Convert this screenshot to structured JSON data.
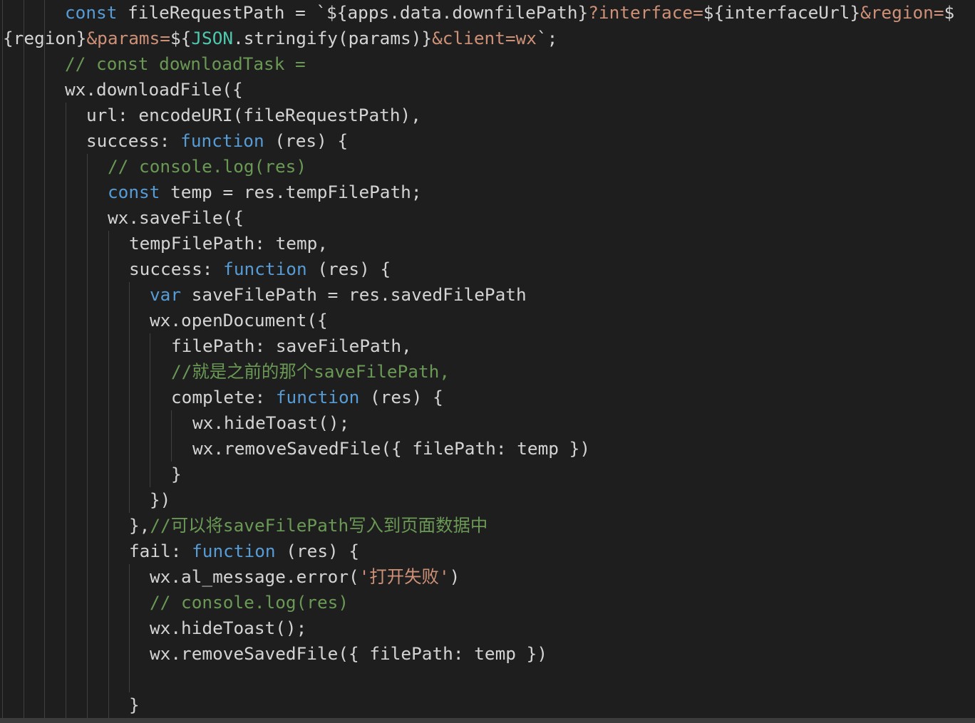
{
  "editor": {
    "colors": {
      "background": "#1e1e1e",
      "keyword": "#569cd6",
      "plain": "#d4d4d4",
      "string": "#ce9178",
      "comment": "#6a9955",
      "type": "#4ec9b0",
      "indent_guide": "#404040"
    },
    "lines": [
      [
        {
          "t": "const",
          "c": "kw"
        },
        {
          "t": " fileRequestPath = `${apps.data.downfilePath}",
          "c": "p"
        },
        {
          "t": "?interface=",
          "c": "str"
        },
        {
          "t": "${interfaceUrl}",
          "c": "p"
        },
        {
          "t": "&region=",
          "c": "str"
        },
        {
          "t": "$",
          "c": "p"
        }
      ],
      [
        {
          "t": "{region}",
          "c": "p"
        },
        {
          "t": "&params=",
          "c": "str"
        },
        {
          "t": "${",
          "c": "p"
        },
        {
          "t": "JSON",
          "c": "ty"
        },
        {
          "t": ".stringify(params)}",
          "c": "p"
        },
        {
          "t": "&client=wx",
          "c": "str"
        },
        {
          "t": "`;",
          "c": "p"
        }
      ],
      [
        {
          "t": "// const downloadTask =",
          "c": "cm"
        }
      ],
      [
        {
          "t": "wx.downloadFile({",
          "c": "p"
        }
      ],
      [
        {
          "t": "url: encodeURI(fileRequestPath),",
          "c": "p"
        }
      ],
      [
        {
          "t": "success: ",
          "c": "p"
        },
        {
          "t": "function",
          "c": "kw"
        },
        {
          "t": " (res) {",
          "c": "p"
        }
      ],
      [
        {
          "t": "// console.log(res)",
          "c": "cm"
        }
      ],
      [
        {
          "t": "const",
          "c": "kw"
        },
        {
          "t": " temp = res.tempFilePath;",
          "c": "p"
        }
      ],
      [
        {
          "t": "wx.saveFile({",
          "c": "p"
        }
      ],
      [
        {
          "t": "tempFilePath: temp,",
          "c": "p"
        }
      ],
      [
        {
          "t": "success: ",
          "c": "p"
        },
        {
          "t": "function",
          "c": "kw"
        },
        {
          "t": " (res) {",
          "c": "p"
        }
      ],
      [
        {
          "t": "var",
          "c": "kw"
        },
        {
          "t": " saveFilePath = res.savedFilePath",
          "c": "p"
        }
      ],
      [
        {
          "t": "wx.openDocument({",
          "c": "p"
        }
      ],
      [
        {
          "t": "filePath: saveFilePath,",
          "c": "p"
        }
      ],
      [
        {
          "t": "//就是之前的那个saveFilePath,",
          "c": "cm"
        }
      ],
      [
        {
          "t": "complete: ",
          "c": "p"
        },
        {
          "t": "function",
          "c": "kw"
        },
        {
          "t": " (res) {",
          "c": "p"
        }
      ],
      [
        {
          "t": "wx.hideToast();",
          "c": "p"
        }
      ],
      [
        {
          "t": "wx.removeSavedFile({ filePath: temp })",
          "c": "p"
        }
      ],
      [
        {
          "t": "}",
          "c": "p"
        }
      ],
      [
        {
          "t": "})",
          "c": "p"
        }
      ],
      [
        {
          "t": "},",
          "c": "p"
        },
        {
          "t": "//可以将saveFilePath写入到页面数据中",
          "c": "cm"
        }
      ],
      [
        {
          "t": "fail: ",
          "c": "p"
        },
        {
          "t": "function",
          "c": "kw"
        },
        {
          "t": " (res) {",
          "c": "p"
        }
      ],
      [
        {
          "t": "wx.al_message.error(",
          "c": "p"
        },
        {
          "t": "'打开失败'",
          "c": "str"
        },
        {
          "t": ")",
          "c": "p"
        }
      ],
      [
        {
          "t": "// console.log(res)",
          "c": "cm"
        }
      ],
      [
        {
          "t": "wx.hideToast();",
          "c": "p"
        }
      ],
      [
        {
          "t": "wx.removeSavedFile({ filePath: temp })",
          "c": "p"
        }
      ],
      [],
      [
        {
          "t": "}",
          "c": "p"
        }
      ]
    ]
  }
}
